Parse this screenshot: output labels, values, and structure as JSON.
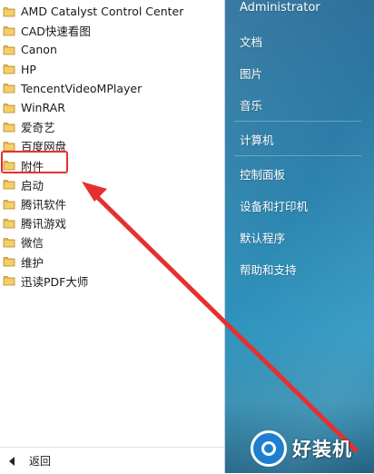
{
  "programs": [
    {
      "label": "AMD Catalyst Control Center"
    },
    {
      "label": "CAD快速看图"
    },
    {
      "label": "Canon"
    },
    {
      "label": "HP"
    },
    {
      "label": "TencentVideoMPlayer"
    },
    {
      "label": "WinRAR"
    },
    {
      "label": "爱奇艺"
    },
    {
      "label": "百度网盘"
    },
    {
      "label": "附件"
    },
    {
      "label": "启动"
    },
    {
      "label": "腾讯软件"
    },
    {
      "label": "腾讯游戏"
    },
    {
      "label": "微信"
    },
    {
      "label": "维护"
    },
    {
      "label": "迅读PDF大师"
    }
  ],
  "back": {
    "label": "返回"
  },
  "right_panel": {
    "user": "Administrator",
    "documents": "文档",
    "pictures": "图片",
    "music": "音乐",
    "computer": "计算机",
    "control_panel": "控制面板",
    "devices_printers": "设备和打印机",
    "default_programs": "默认程序",
    "help_support": "帮助和支持"
  },
  "watermark": {
    "text": "好装机"
  },
  "colors": {
    "highlight": "#e63030",
    "arrow": "#e63030",
    "folder": "#e7b84a",
    "panel": "#2d83ad"
  }
}
